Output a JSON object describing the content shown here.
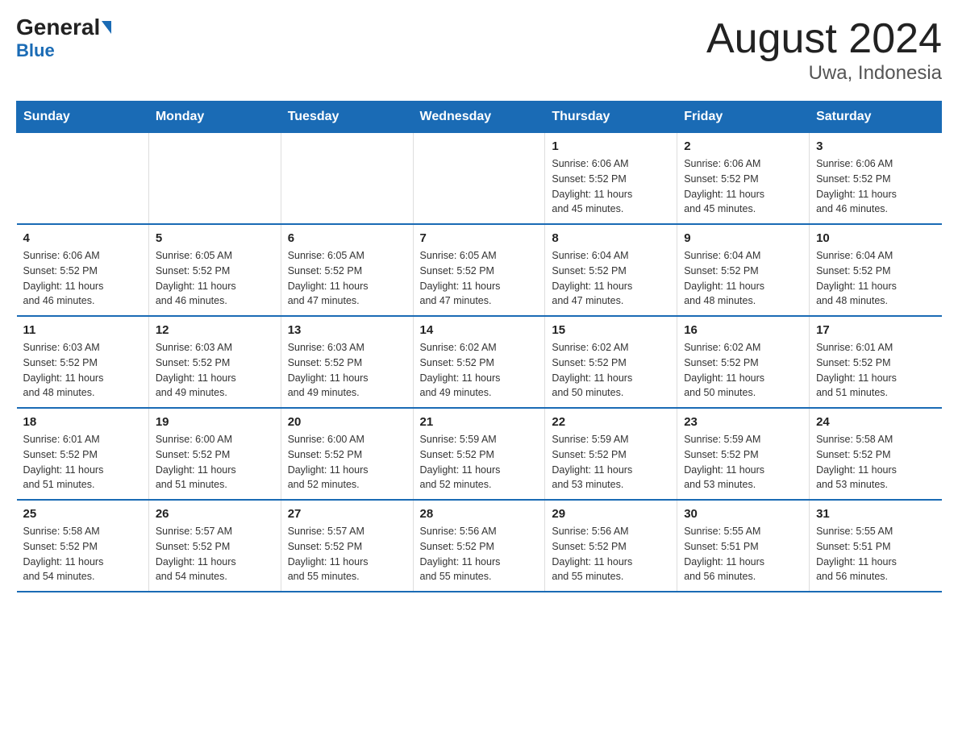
{
  "header": {
    "logo_general": "General",
    "logo_blue": "Blue",
    "title": "August 2024",
    "subtitle": "Uwa, Indonesia"
  },
  "days_of_week": [
    "Sunday",
    "Monday",
    "Tuesday",
    "Wednesday",
    "Thursday",
    "Friday",
    "Saturday"
  ],
  "weeks": [
    [
      {
        "day": "",
        "info": ""
      },
      {
        "day": "",
        "info": ""
      },
      {
        "day": "",
        "info": ""
      },
      {
        "day": "",
        "info": ""
      },
      {
        "day": "1",
        "info": "Sunrise: 6:06 AM\nSunset: 5:52 PM\nDaylight: 11 hours\nand 45 minutes."
      },
      {
        "day": "2",
        "info": "Sunrise: 6:06 AM\nSunset: 5:52 PM\nDaylight: 11 hours\nand 45 minutes."
      },
      {
        "day": "3",
        "info": "Sunrise: 6:06 AM\nSunset: 5:52 PM\nDaylight: 11 hours\nand 46 minutes."
      }
    ],
    [
      {
        "day": "4",
        "info": "Sunrise: 6:06 AM\nSunset: 5:52 PM\nDaylight: 11 hours\nand 46 minutes."
      },
      {
        "day": "5",
        "info": "Sunrise: 6:05 AM\nSunset: 5:52 PM\nDaylight: 11 hours\nand 46 minutes."
      },
      {
        "day": "6",
        "info": "Sunrise: 6:05 AM\nSunset: 5:52 PM\nDaylight: 11 hours\nand 47 minutes."
      },
      {
        "day": "7",
        "info": "Sunrise: 6:05 AM\nSunset: 5:52 PM\nDaylight: 11 hours\nand 47 minutes."
      },
      {
        "day": "8",
        "info": "Sunrise: 6:04 AM\nSunset: 5:52 PM\nDaylight: 11 hours\nand 47 minutes."
      },
      {
        "day": "9",
        "info": "Sunrise: 6:04 AM\nSunset: 5:52 PM\nDaylight: 11 hours\nand 48 minutes."
      },
      {
        "day": "10",
        "info": "Sunrise: 6:04 AM\nSunset: 5:52 PM\nDaylight: 11 hours\nand 48 minutes."
      }
    ],
    [
      {
        "day": "11",
        "info": "Sunrise: 6:03 AM\nSunset: 5:52 PM\nDaylight: 11 hours\nand 48 minutes."
      },
      {
        "day": "12",
        "info": "Sunrise: 6:03 AM\nSunset: 5:52 PM\nDaylight: 11 hours\nand 49 minutes."
      },
      {
        "day": "13",
        "info": "Sunrise: 6:03 AM\nSunset: 5:52 PM\nDaylight: 11 hours\nand 49 minutes."
      },
      {
        "day": "14",
        "info": "Sunrise: 6:02 AM\nSunset: 5:52 PM\nDaylight: 11 hours\nand 49 minutes."
      },
      {
        "day": "15",
        "info": "Sunrise: 6:02 AM\nSunset: 5:52 PM\nDaylight: 11 hours\nand 50 minutes."
      },
      {
        "day": "16",
        "info": "Sunrise: 6:02 AM\nSunset: 5:52 PM\nDaylight: 11 hours\nand 50 minutes."
      },
      {
        "day": "17",
        "info": "Sunrise: 6:01 AM\nSunset: 5:52 PM\nDaylight: 11 hours\nand 51 minutes."
      }
    ],
    [
      {
        "day": "18",
        "info": "Sunrise: 6:01 AM\nSunset: 5:52 PM\nDaylight: 11 hours\nand 51 minutes."
      },
      {
        "day": "19",
        "info": "Sunrise: 6:00 AM\nSunset: 5:52 PM\nDaylight: 11 hours\nand 51 minutes."
      },
      {
        "day": "20",
        "info": "Sunrise: 6:00 AM\nSunset: 5:52 PM\nDaylight: 11 hours\nand 52 minutes."
      },
      {
        "day": "21",
        "info": "Sunrise: 5:59 AM\nSunset: 5:52 PM\nDaylight: 11 hours\nand 52 minutes."
      },
      {
        "day": "22",
        "info": "Sunrise: 5:59 AM\nSunset: 5:52 PM\nDaylight: 11 hours\nand 53 minutes."
      },
      {
        "day": "23",
        "info": "Sunrise: 5:59 AM\nSunset: 5:52 PM\nDaylight: 11 hours\nand 53 minutes."
      },
      {
        "day": "24",
        "info": "Sunrise: 5:58 AM\nSunset: 5:52 PM\nDaylight: 11 hours\nand 53 minutes."
      }
    ],
    [
      {
        "day": "25",
        "info": "Sunrise: 5:58 AM\nSunset: 5:52 PM\nDaylight: 11 hours\nand 54 minutes."
      },
      {
        "day": "26",
        "info": "Sunrise: 5:57 AM\nSunset: 5:52 PM\nDaylight: 11 hours\nand 54 minutes."
      },
      {
        "day": "27",
        "info": "Sunrise: 5:57 AM\nSunset: 5:52 PM\nDaylight: 11 hours\nand 55 minutes."
      },
      {
        "day": "28",
        "info": "Sunrise: 5:56 AM\nSunset: 5:52 PM\nDaylight: 11 hours\nand 55 minutes."
      },
      {
        "day": "29",
        "info": "Sunrise: 5:56 AM\nSunset: 5:52 PM\nDaylight: 11 hours\nand 55 minutes."
      },
      {
        "day": "30",
        "info": "Sunrise: 5:55 AM\nSunset: 5:51 PM\nDaylight: 11 hours\nand 56 minutes."
      },
      {
        "day": "31",
        "info": "Sunrise: 5:55 AM\nSunset: 5:51 PM\nDaylight: 11 hours\nand 56 minutes."
      }
    ]
  ]
}
